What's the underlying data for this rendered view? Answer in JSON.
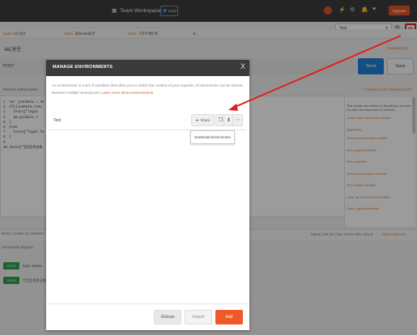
{
  "header": {
    "workspace_label": "Team Workspace",
    "invite_label": "Invite",
    "upgrade_label": "Upgrade",
    "environment_selected": "Test",
    "accent": "#e0532b"
  },
  "tabs": [
    {
      "method": "POST",
      "label": "AIC용운"
    },
    {
      "method": "POST",
      "label": "물류Hub통관"
    },
    {
      "method": "POST",
      "label": "기관우체분류"
    }
  ],
  "request": {
    "title": "AIC용운",
    "examples": "Examples (0)",
    "method": "POST",
    "send_label": "Send",
    "save_label": "Save",
    "subtabs": "Params    Authorization",
    "links": "Cookies  Code  Comments (0)",
    "code": "1  var jsonData = JS\n2  if(jsonData.resu\n3    tests[\"login\n4    pm.globals.s\n5  }\n6  else\n7    tests[\"login fa\n8  }\n9\n10 tests[\"정립등록실패"
  },
  "snippets": {
    "desc": "Test scripts are written in JavaScript, and are run after the response is received.",
    "learn": "Learn more about tests scripts",
    "section": "SNIPPETS",
    "items": [
      "Get an environment variable",
      "Get a global variable",
      "Get a variable",
      "Set an environment variable",
      "Set a global variable",
      "Clear an environment variable",
      "Clear a global variable"
    ]
  },
  "response": {
    "tabs": "Body   Cookies (1)   Headers",
    "status": "Status: 200 OK    Time: 971ms    Size: 831 B",
    "save_response": "Save Response",
    "result_tabs": "All    Passed    Skipped",
    "results": [
      {
        "badge": "PASS",
        "label": "login Status"
      },
      {
        "badge": "PASS",
        "label": "인입등록성공통과"
      }
    ]
  },
  "modal": {
    "title": "MANAGE ENVIRONMENTS",
    "close": "X",
    "description": "An environment is a set of variables that allow you to switch the context of your requests. Environments can be shared between multiple workspaces.",
    "learn_more": "Learn more about environments",
    "environment_name": "Test",
    "share_label": "Share",
    "tooltip": "Download Environment",
    "globals_label": "Globals",
    "import_label": "Import",
    "add_label": "Add"
  }
}
